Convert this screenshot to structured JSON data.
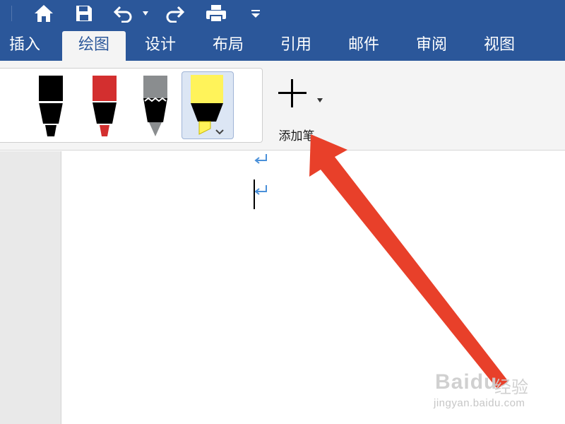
{
  "toolbar": {
    "icons": [
      "home-icon",
      "save-icon",
      "undo-icon",
      "dropdown-arrow-icon",
      "redo-icon",
      "print-icon",
      "customize-toolbar-icon"
    ]
  },
  "tabs": [
    {
      "label": "插入",
      "active": false
    },
    {
      "label": "绘图",
      "active": true
    },
    {
      "label": "设计",
      "active": false
    },
    {
      "label": "布局",
      "active": false
    },
    {
      "label": "引用",
      "active": false
    },
    {
      "label": "邮件",
      "active": false
    },
    {
      "label": "审阅",
      "active": false
    },
    {
      "label": "视图",
      "active": false
    }
  ],
  "ribbon": {
    "pens": [
      {
        "name": "black-pen",
        "color": "#000000"
      },
      {
        "name": "red-pen",
        "color": "#d32f2f"
      },
      {
        "name": "pencil",
        "color": "#8a8d8f"
      },
      {
        "name": "highlighter",
        "color": "#fff35a",
        "selected": true
      }
    ],
    "add_pen_label": "添加笔"
  },
  "colors": {
    "title_bar": "#2b579a",
    "ribbon_bg": "#f4f4f4",
    "paragraph_mark": "#4a90d9",
    "annotation_arrow": "#e8402a"
  },
  "watermark": {
    "brand": "Bai",
    "brand_suffix": "du",
    "cn": "经验",
    "url": "jingyan.baidu.com"
  }
}
